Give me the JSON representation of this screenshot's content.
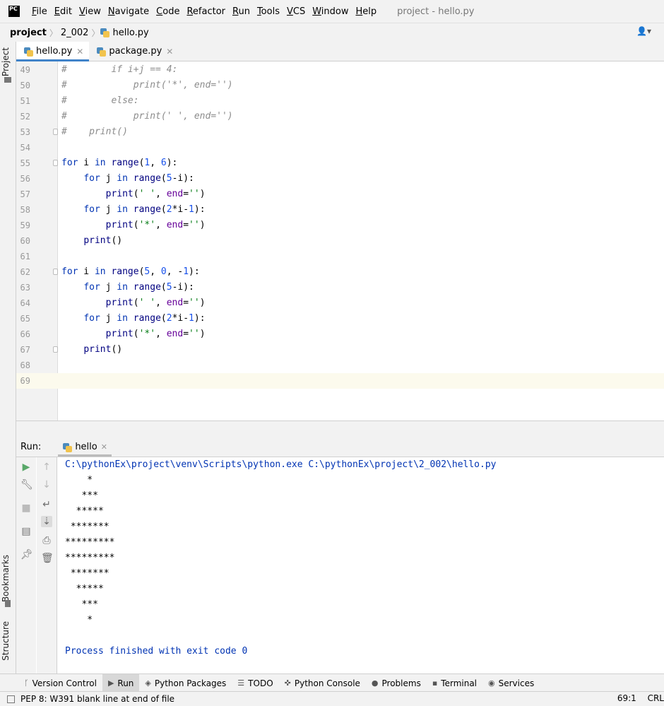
{
  "menubar": {
    "logo_text": "PC",
    "items": [
      {
        "u": "F",
        "rest": "ile"
      },
      {
        "u": "E",
        "rest": "dit"
      },
      {
        "u": "V",
        "rest": "iew"
      },
      {
        "u": "N",
        "rest": "avigate"
      },
      {
        "u": "C",
        "rest": "ode"
      },
      {
        "u": "R",
        "rest": "efactor"
      },
      {
        "u": "R",
        "rest": "un"
      },
      {
        "u": "T",
        "rest": "ools"
      },
      {
        "u": "V",
        "rest": "CS"
      },
      {
        "u": "W",
        "rest": "indow"
      },
      {
        "u": "H",
        "rest": "elp"
      }
    ],
    "title": "project - hello.py"
  },
  "navbar": {
    "crumbs": [
      "project",
      "2_002",
      "hello.py"
    ],
    "user_icon": "user-icon"
  },
  "left_strip": {
    "project_label": "Project",
    "bookmarks_label": "Bookmarks",
    "structure_label": "Structure"
  },
  "tabs": [
    {
      "label": "hello.py",
      "active": true
    },
    {
      "label": "package.py",
      "active": false
    }
  ],
  "editor": {
    "current_line": "69",
    "lines": [
      {
        "n": "49",
        "tokens": [
          {
            "c": "cmt",
            "t": "#        if i+j == 4:"
          }
        ]
      },
      {
        "n": "50",
        "tokens": [
          {
            "c": "cmt",
            "t": "#            print('*', end='')"
          }
        ]
      },
      {
        "n": "51",
        "tokens": [
          {
            "c": "cmt",
            "t": "#        else:"
          }
        ]
      },
      {
        "n": "52",
        "tokens": [
          {
            "c": "cmt",
            "t": "#            print(' ', end='')"
          }
        ]
      },
      {
        "n": "53",
        "fold": true,
        "tokens": [
          {
            "c": "cmt",
            "t": "#    print()"
          }
        ]
      },
      {
        "n": "54",
        "tokens": []
      },
      {
        "n": "55",
        "fold": true,
        "tokens": [
          {
            "c": "kw",
            "t": "for"
          },
          {
            "c": "",
            "t": " i "
          },
          {
            "c": "kw",
            "t": "in"
          },
          {
            "c": "",
            "t": " "
          },
          {
            "c": "fn",
            "t": "range"
          },
          {
            "c": "",
            "t": "("
          },
          {
            "c": "num",
            "t": "1"
          },
          {
            "c": "",
            "t": ", "
          },
          {
            "c": "num",
            "t": "6"
          },
          {
            "c": "",
            "t": "):"
          }
        ]
      },
      {
        "n": "56",
        "tokens": [
          {
            "c": "",
            "t": "    "
          },
          {
            "c": "kw",
            "t": "for"
          },
          {
            "c": "",
            "t": " j "
          },
          {
            "c": "kw",
            "t": "in"
          },
          {
            "c": "",
            "t": " "
          },
          {
            "c": "fn",
            "t": "range"
          },
          {
            "c": "",
            "t": "("
          },
          {
            "c": "num",
            "t": "5"
          },
          {
            "c": "",
            "t": "-i):"
          }
        ]
      },
      {
        "n": "57",
        "tokens": [
          {
            "c": "",
            "t": "        "
          },
          {
            "c": "fn",
            "t": "print"
          },
          {
            "c": "",
            "t": "("
          },
          {
            "c": "str",
            "t": "' '"
          },
          {
            "c": "",
            "t": ", "
          },
          {
            "c": "param",
            "t": "end"
          },
          {
            "c": "",
            "t": "="
          },
          {
            "c": "str",
            "t": "''"
          },
          {
            "c": "",
            "t": ")"
          }
        ]
      },
      {
        "n": "58",
        "tokens": [
          {
            "c": "",
            "t": "    "
          },
          {
            "c": "kw",
            "t": "for"
          },
          {
            "c": "",
            "t": " j "
          },
          {
            "c": "kw",
            "t": "in"
          },
          {
            "c": "",
            "t": " "
          },
          {
            "c": "fn",
            "t": "range"
          },
          {
            "c": "",
            "t": "("
          },
          {
            "c": "num",
            "t": "2"
          },
          {
            "c": "",
            "t": "*i-"
          },
          {
            "c": "num",
            "t": "1"
          },
          {
            "c": "",
            "t": "):"
          }
        ]
      },
      {
        "n": "59",
        "tokens": [
          {
            "c": "",
            "t": "        "
          },
          {
            "c": "fn",
            "t": "print"
          },
          {
            "c": "",
            "t": "("
          },
          {
            "c": "str",
            "t": "'*'"
          },
          {
            "c": "",
            "t": ", "
          },
          {
            "c": "param",
            "t": "end"
          },
          {
            "c": "",
            "t": "="
          },
          {
            "c": "str",
            "t": "''"
          },
          {
            "c": "",
            "t": ")"
          }
        ]
      },
      {
        "n": "60",
        "tokens": [
          {
            "c": "",
            "t": "    "
          },
          {
            "c": "fn",
            "t": "print"
          },
          {
            "c": "",
            "t": "()"
          }
        ]
      },
      {
        "n": "61",
        "tokens": []
      },
      {
        "n": "62",
        "fold": true,
        "tokens": [
          {
            "c": "kw",
            "t": "for"
          },
          {
            "c": "",
            "t": " i "
          },
          {
            "c": "kw",
            "t": "in"
          },
          {
            "c": "",
            "t": " "
          },
          {
            "c": "fn",
            "t": "range"
          },
          {
            "c": "",
            "t": "("
          },
          {
            "c": "num",
            "t": "5"
          },
          {
            "c": "",
            "t": ", "
          },
          {
            "c": "num",
            "t": "0"
          },
          {
            "c": "",
            "t": ", -"
          },
          {
            "c": "num",
            "t": "1"
          },
          {
            "c": "",
            "t": "):"
          }
        ]
      },
      {
        "n": "63",
        "tokens": [
          {
            "c": "",
            "t": "    "
          },
          {
            "c": "kw",
            "t": "for"
          },
          {
            "c": "",
            "t": " j "
          },
          {
            "c": "kw",
            "t": "in"
          },
          {
            "c": "",
            "t": " "
          },
          {
            "c": "fn",
            "t": "range"
          },
          {
            "c": "",
            "t": "("
          },
          {
            "c": "num",
            "t": "5"
          },
          {
            "c": "",
            "t": "-i):"
          }
        ]
      },
      {
        "n": "64",
        "tokens": [
          {
            "c": "",
            "t": "        "
          },
          {
            "c": "fn",
            "t": "print"
          },
          {
            "c": "",
            "t": "("
          },
          {
            "c": "str",
            "t": "' '"
          },
          {
            "c": "",
            "t": ", "
          },
          {
            "c": "param",
            "t": "end"
          },
          {
            "c": "",
            "t": "="
          },
          {
            "c": "str",
            "t": "''"
          },
          {
            "c": "",
            "t": ")"
          }
        ]
      },
      {
        "n": "65",
        "tokens": [
          {
            "c": "",
            "t": "    "
          },
          {
            "c": "kw",
            "t": "for"
          },
          {
            "c": "",
            "t": " j "
          },
          {
            "c": "kw",
            "t": "in"
          },
          {
            "c": "",
            "t": " "
          },
          {
            "c": "fn",
            "t": "range"
          },
          {
            "c": "",
            "t": "("
          },
          {
            "c": "num",
            "t": "2"
          },
          {
            "c": "",
            "t": "*i-"
          },
          {
            "c": "num",
            "t": "1"
          },
          {
            "c": "",
            "t": "):"
          }
        ]
      },
      {
        "n": "66",
        "tokens": [
          {
            "c": "",
            "t": "        "
          },
          {
            "c": "fn",
            "t": "print"
          },
          {
            "c": "",
            "t": "("
          },
          {
            "c": "str",
            "t": "'*'"
          },
          {
            "c": "",
            "t": ", "
          },
          {
            "c": "param",
            "t": "end"
          },
          {
            "c": "",
            "t": "="
          },
          {
            "c": "str",
            "t": "''"
          },
          {
            "c": "",
            "t": ")"
          }
        ]
      },
      {
        "n": "67",
        "fold": true,
        "tokens": [
          {
            "c": "",
            "t": "    "
          },
          {
            "c": "fn",
            "t": "print"
          },
          {
            "c": "",
            "t": "()"
          }
        ]
      },
      {
        "n": "68",
        "tokens": []
      },
      {
        "n": "69",
        "tokens": []
      }
    ]
  },
  "run": {
    "label": "Run:",
    "tab_label": "hello",
    "console": [
      {
        "sys": true,
        "t": "C:\\pythonEx\\project\\venv\\Scripts\\python.exe C:\\pythonEx\\project\\2_002\\hello.py"
      },
      {
        "t": "    *"
      },
      {
        "t": "   ***"
      },
      {
        "t": "  *****"
      },
      {
        "t": " *******"
      },
      {
        "t": "*********"
      },
      {
        "t": "*********"
      },
      {
        "t": " *******"
      },
      {
        "t": "  *****"
      },
      {
        "t": "   ***"
      },
      {
        "t": "    *"
      },
      {
        "t": ""
      },
      {
        "sys": true,
        "t": "Process finished with exit code 0"
      }
    ]
  },
  "bottom_tabs": [
    {
      "label": "Version Control",
      "icon": "branch-icon",
      "glyph": "ᚴ"
    },
    {
      "label": "Run",
      "icon": "run-icon",
      "glyph": "▶",
      "active": true
    },
    {
      "label": "Python Packages",
      "icon": "layers-icon",
      "glyph": "◈"
    },
    {
      "label": "TODO",
      "icon": "list-icon",
      "glyph": "☰"
    },
    {
      "label": "Python Console",
      "icon": "python-icon",
      "glyph": "✜"
    },
    {
      "label": "Problems",
      "icon": "info-icon",
      "glyph": "●"
    },
    {
      "label": "Terminal",
      "icon": "terminal-icon",
      "glyph": "▪"
    },
    {
      "label": "Services",
      "icon": "services-icon",
      "glyph": "◉"
    }
  ],
  "status": {
    "message": "PEP 8: W391 blank line at end of file",
    "position": "69:1",
    "line_sep": "CRL"
  }
}
